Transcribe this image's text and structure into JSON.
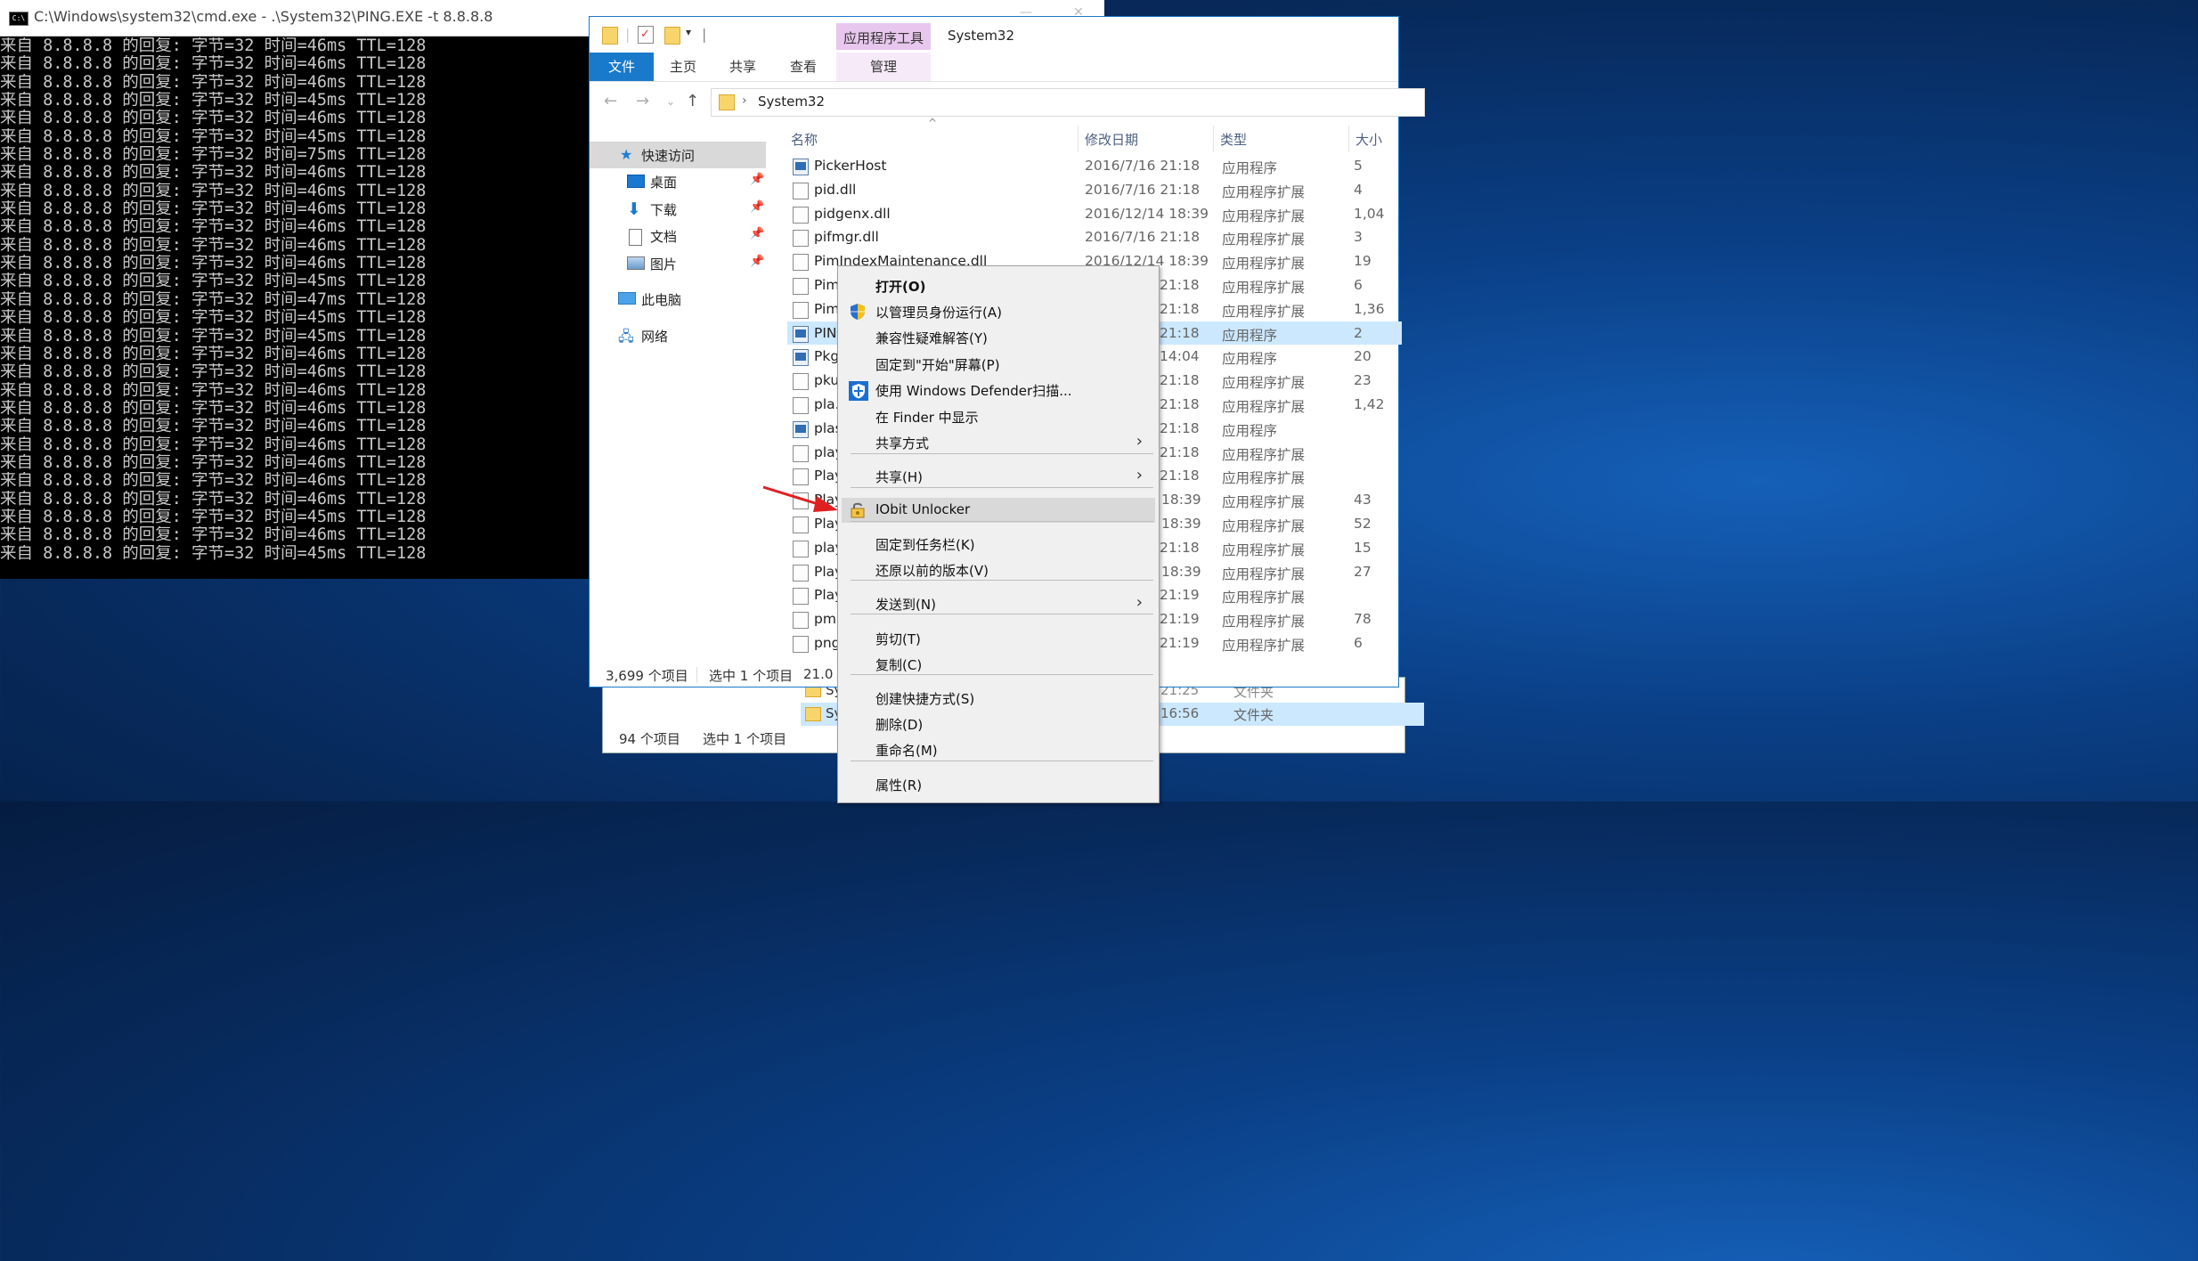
{
  "cmd": {
    "title": "C:\\Windows\\system32\\cmd.exe - .\\System32\\PING.EXE  -t 8.8.8.8",
    "lines": [
      "来自 8.8.8.8 的回复: 字节=32 时间=46ms TTL=128",
      "来自 8.8.8.8 的回复: 字节=32 时间=46ms TTL=128",
      "来自 8.8.8.8 的回复: 字节=32 时间=46ms TTL=128",
      "来自 8.8.8.8 的回复: 字节=32 时间=45ms TTL=128",
      "来自 8.8.8.8 的回复: 字节=32 时间=46ms TTL=128",
      "来自 8.8.8.8 的回复: 字节=32 时间=45ms TTL=128",
      "来自 8.8.8.8 的回复: 字节=32 时间=75ms TTL=128",
      "来自 8.8.8.8 的回复: 字节=32 时间=46ms TTL=128",
      "来自 8.8.8.8 的回复: 字节=32 时间=46ms TTL=128",
      "来自 8.8.8.8 的回复: 字节=32 时间=46ms TTL=128",
      "来自 8.8.8.8 的回复: 字节=32 时间=46ms TTL=128",
      "来自 8.8.8.8 的回复: 字节=32 时间=46ms TTL=128",
      "来自 8.8.8.8 的回复: 字节=32 时间=46ms TTL=128",
      "来自 8.8.8.8 的回复: 字节=32 时间=45ms TTL=128",
      "来自 8.8.8.8 的回复: 字节=32 时间=47ms TTL=128",
      "来自 8.8.8.8 的回复: 字节=32 时间=45ms TTL=128",
      "来自 8.8.8.8 的回复: 字节=32 时间=45ms TTL=128",
      "来自 8.8.8.8 的回复: 字节=32 时间=46ms TTL=128",
      "来自 8.8.8.8 的回复: 字节=32 时间=46ms TTL=128",
      "来自 8.8.8.8 的回复: 字节=32 时间=46ms TTL=128",
      "来自 8.8.8.8 的回复: 字节=32 时间=46ms TTL=128",
      "来自 8.8.8.8 的回复: 字节=32 时间=46ms TTL=128",
      "来自 8.8.8.8 的回复: 字节=32 时间=46ms TTL=128",
      "来自 8.8.8.8 的回复: 字节=32 时间=46ms TTL=128",
      "来自 8.8.8.8 的回复: 字节=32 时间=46ms TTL=128",
      "来自 8.8.8.8 的回复: 字节=32 时间=46ms TTL=128",
      "来自 8.8.8.8 的回复: 字节=32 时间=45ms TTL=128",
      "来自 8.8.8.8 的回复: 字节=32 时间=46ms TTL=128",
      "来自 8.8.8.8 的回复: 字节=32 时间=45ms TTL=128"
    ]
  },
  "explorer": {
    "title": "System32",
    "app_tools_tab": "应用程序工具",
    "ribbon_tabs": [
      "文件",
      "主页",
      "共享",
      "查看"
    ],
    "manage_tab": "管理",
    "breadcrumb": "System32",
    "nav": {
      "quick_access": "快速访问",
      "desktop": "桌面",
      "downloads": "下载",
      "documents": "文档",
      "pictures": "图片",
      "this_pc": "此电脑",
      "network": "网络"
    },
    "columns": {
      "name": "名称",
      "date": "修改日期",
      "type": "类型",
      "size": "大小"
    },
    "files": [
      {
        "name": "PickerHost",
        "date": "2016/7/16 21:18",
        "type": "应用程序",
        "size": "5",
        "icon": "exe"
      },
      {
        "name": "pid.dll",
        "date": "2016/7/16 21:18",
        "type": "应用程序扩展",
        "size": "4",
        "icon": "dll"
      },
      {
        "name": "pidgenx.dll",
        "date": "2016/12/14 18:39",
        "type": "应用程序扩展",
        "size": "1,04",
        "icon": "dll"
      },
      {
        "name": "pifmgr.dll",
        "date": "2016/7/16 21:18",
        "type": "应用程序扩展",
        "size": "3",
        "icon": "dll"
      },
      {
        "name": "PimIndexMaintenance.dll",
        "date": "2016/12/14 18:39",
        "type": "应用程序扩展",
        "size": "19",
        "icon": "dll"
      },
      {
        "name": "Pim",
        "date": "21:18",
        "type": "应用程序扩展",
        "size": "6",
        "icon": "dll"
      },
      {
        "name": "Pim",
        "date": "21:18",
        "type": "应用程序扩展",
        "size": "1,36",
        "icon": "dll"
      },
      {
        "name": "PIN",
        "date": "21:18",
        "type": "应用程序",
        "size": "2",
        "icon": "exe"
      },
      {
        "name": "Pkg",
        "date": "14:04",
        "type": "应用程序",
        "size": "20",
        "icon": "exe"
      },
      {
        "name": "pku",
        "date": "21:18",
        "type": "应用程序扩展",
        "size": "23",
        "icon": "dll"
      },
      {
        "name": "pla.",
        "date": "21:18",
        "type": "应用程序扩展",
        "size": "1,42",
        "icon": "dll"
      },
      {
        "name": "plas",
        "date": "21:18",
        "type": "应用程序",
        "size": "",
        "icon": "exe"
      },
      {
        "name": "play",
        "date": "21:18",
        "type": "应用程序扩展",
        "size": "",
        "icon": "dll"
      },
      {
        "name": "Play",
        "date": "21:18",
        "type": "应用程序扩展",
        "size": "",
        "icon": "dll"
      },
      {
        "name": "Play",
        "date": "18:39",
        "type": "应用程序扩展",
        "size": "43",
        "icon": "dll"
      },
      {
        "name": "Play",
        "date": "18:39",
        "type": "应用程序扩展",
        "size": "52",
        "icon": "dll"
      },
      {
        "name": "play",
        "date": "21:18",
        "type": "应用程序扩展",
        "size": "15",
        "icon": "dll"
      },
      {
        "name": "Play",
        "date": "18:39",
        "type": "应用程序扩展",
        "size": "27",
        "icon": "dll"
      },
      {
        "name": "Play",
        "date": "21:19",
        "type": "应用程序扩展",
        "size": "",
        "icon": "dll"
      },
      {
        "name": "pm",
        "date": "21:19",
        "type": "应用程序扩展",
        "size": "78",
        "icon": "dll"
      },
      {
        "name": "png",
        "date": "21:19",
        "type": "应用程序扩展",
        "size": "6",
        "icon": "dll"
      }
    ],
    "status": {
      "count": "3,699 个项目",
      "selected": "选中 1 个项目",
      "size": "21.0"
    }
  },
  "back_window": {
    "rows": [
      {
        "name": "Sy",
        "date": "21:25",
        "type": "文件夹"
      },
      {
        "name": "Sy",
        "date": "16:56",
        "type": "文件夹"
      }
    ],
    "status": {
      "count": "94 个项目",
      "selected": "选中 1 个项目"
    }
  },
  "context_menu": {
    "items": [
      {
        "label": "打开(O)",
        "bold": true
      },
      {
        "label": "以管理员身份运行(A)",
        "icon": "uac-shield-icon"
      },
      {
        "label": "兼容性疑难解答(Y)"
      },
      {
        "label": "固定到\"开始\"屏幕(P)"
      },
      {
        "label": "使用 Windows Defender扫描...",
        "icon": "defender-shield-icon"
      },
      {
        "label": "在 Finder 中显示"
      },
      {
        "label": "共享方式",
        "submenu": true
      },
      {
        "label": "共享(H)",
        "submenu": true
      },
      {
        "label": "IObit Unlocker",
        "icon": "unlocker-icon",
        "highlighted": true
      },
      {
        "label": "固定到任务栏(K)"
      },
      {
        "label": "还原以前的版本(V)"
      },
      {
        "label": "发送到(N)",
        "submenu": true
      },
      {
        "label": "剪切(T)"
      },
      {
        "label": "复制(C)"
      },
      {
        "label": "创建快捷方式(S)"
      },
      {
        "label": "删除(D)"
      },
      {
        "label": "重命名(M)"
      },
      {
        "label": "属性(R)"
      }
    ]
  },
  "colors": {
    "accent": "#1979ca",
    "selection": "#cce8ff",
    "app_tools": "#e8c7ee",
    "annotation_arrow": "#e02020"
  }
}
